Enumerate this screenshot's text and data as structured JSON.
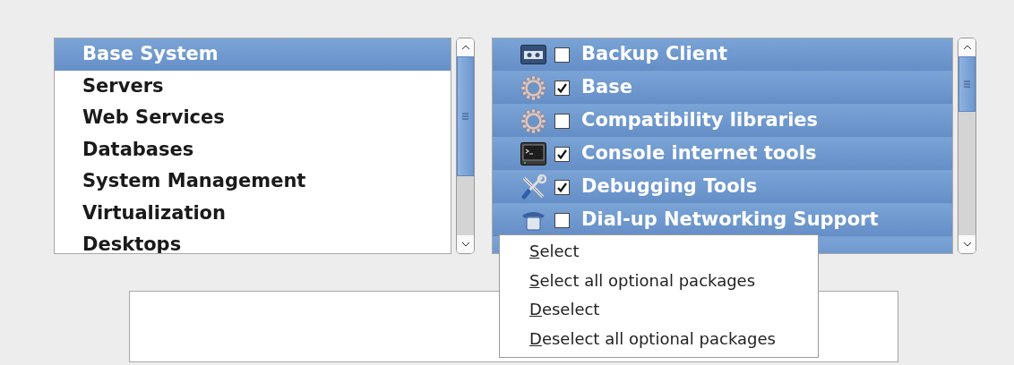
{
  "groups": [
    {
      "label": "Base System",
      "selected": true
    },
    {
      "label": "Servers",
      "selected": false
    },
    {
      "label": "Web Services",
      "selected": false
    },
    {
      "label": "Databases",
      "selected": false
    },
    {
      "label": "System Management",
      "selected": false
    },
    {
      "label": "Virtualization",
      "selected": false
    },
    {
      "label": "Desktops",
      "selected": false
    }
  ],
  "packages": [
    {
      "label": "Backup Client",
      "checked": false
    },
    {
      "label": "Base",
      "checked": true
    },
    {
      "label": "Compatibility libraries",
      "checked": false
    },
    {
      "label": "Console internet tools",
      "checked": true
    },
    {
      "label": "Debugging Tools",
      "checked": true
    },
    {
      "label": "Dial-up Networking Support",
      "checked": false
    }
  ],
  "context_menu": [
    "Select",
    "Select all optional packages",
    "Deselect",
    "Deselect all optional packages"
  ]
}
